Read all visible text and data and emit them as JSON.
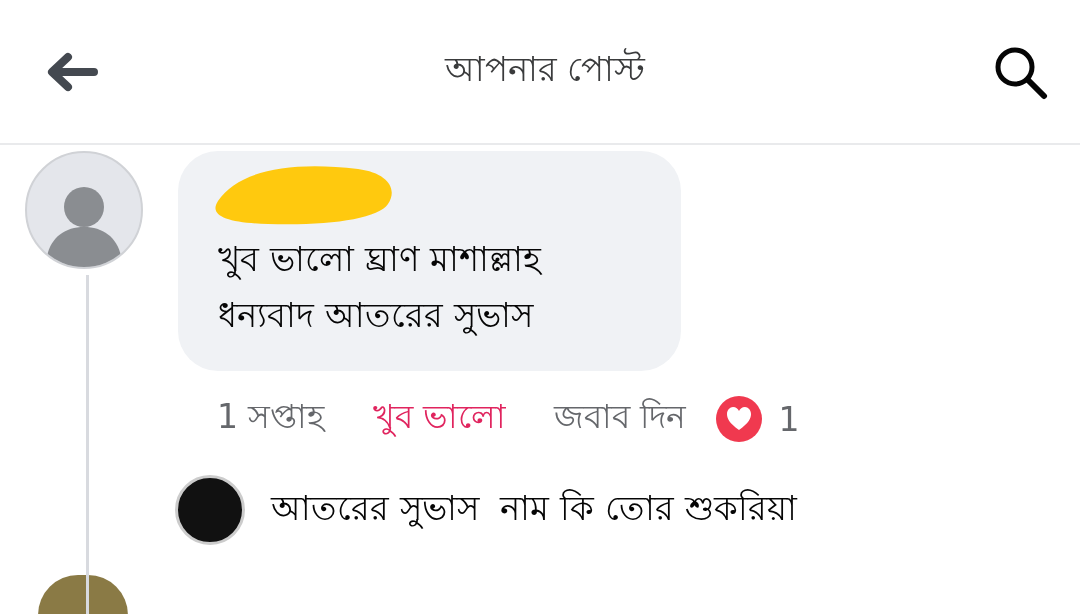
{
  "header": {
    "title": "আপনার পোস্ট"
  },
  "comment": {
    "body_lines": [
      "খুব ভালো ঘ্রাণ মাশাল্লাহ",
      "ধন্যবাদ আতরের সুভাস"
    ],
    "time": "1 সপ্তাহ",
    "reaction_label": "খুব ভালো",
    "reacted": true,
    "reply_action": "জবাব দিন",
    "reaction_count": "1"
  },
  "reply": {
    "author": "আতরের সুভাস",
    "text": "নাম কি তোর শুকরিয়া"
  }
}
